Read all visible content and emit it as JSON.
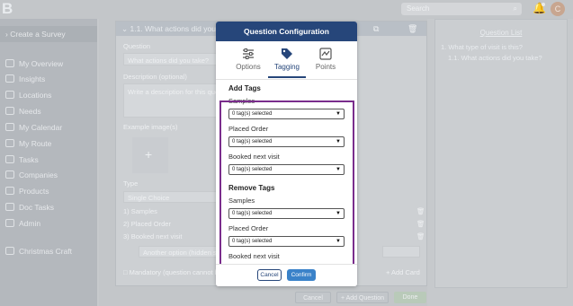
{
  "app": {
    "logo_letter": "B",
    "search_placeholder": "Search",
    "avatar_initial": "C"
  },
  "sidebar": {
    "create_label": "Create a Survey",
    "items": [
      {
        "label": "My Overview"
      },
      {
        "label": "Insights"
      },
      {
        "label": "Locations"
      },
      {
        "label": "Needs"
      },
      {
        "label": "My Calendar"
      },
      {
        "label": "My Route"
      },
      {
        "label": "Tasks"
      },
      {
        "label": "Companies"
      },
      {
        "label": "Products"
      },
      {
        "label": "Doc Tasks"
      },
      {
        "label": "Admin"
      },
      {
        "label": "Christmas Craft"
      }
    ]
  },
  "editor": {
    "question_header": "1.1. What actions did you tak",
    "question_label": "Question",
    "question_value": "What actions did you take?",
    "description_label": "Description (optional)",
    "description_placeholder": "Write a description for this que",
    "images_label": "Example image(s)",
    "type_label": "Type",
    "type_value": "Single Choice",
    "options": [
      "1) Samples",
      "2) Placed Order",
      "3) Booked next visit"
    ],
    "another_option_placeholder": "Another option (hidden start)",
    "mandatory_text": "Mandatory (question cannot be skipp",
    "add_card_label": "+ Add Card"
  },
  "question_list": {
    "title": "Question List",
    "items": [
      "1. What type of visit is this?",
      "1.1. What actions did you take?"
    ]
  },
  "bottom_bar": {
    "cancel_label": "Cancel",
    "add_question_label": "+ Add Question",
    "done_label": "Done"
  },
  "modal": {
    "title": "Question Configuration",
    "tabs": [
      {
        "label": "Options",
        "icon": "sliders-icon"
      },
      {
        "label": "Tagging",
        "icon": "tag-icon"
      },
      {
        "label": "Points",
        "icon": "points-icon"
      }
    ],
    "active_tab": "Tagging",
    "add_tags": {
      "heading": "Add Tags",
      "fields": [
        {
          "label": "Samples",
          "value": "0 tag(s) selected"
        },
        {
          "label": "Placed Order",
          "value": "0 tag(s) selected"
        },
        {
          "label": "Booked next visit",
          "value": "0 tag(s) selected"
        }
      ]
    },
    "remove_tags": {
      "heading": "Remove Tags",
      "fields": [
        {
          "label": "Samples",
          "value": "0 tag(s) selected"
        },
        {
          "label": "Placed Order",
          "value": "0 tag(s) selected"
        },
        {
          "label": "Booked next visit",
          "value": ""
        }
      ]
    },
    "cancel_label": "Cancel",
    "confirm_label": "Confirm"
  },
  "colors": {
    "modal_header": "#26467a",
    "confirm_button": "#3a82c9",
    "highlight_border": "#7a2d8c",
    "overlay": "#c6c9cc"
  }
}
